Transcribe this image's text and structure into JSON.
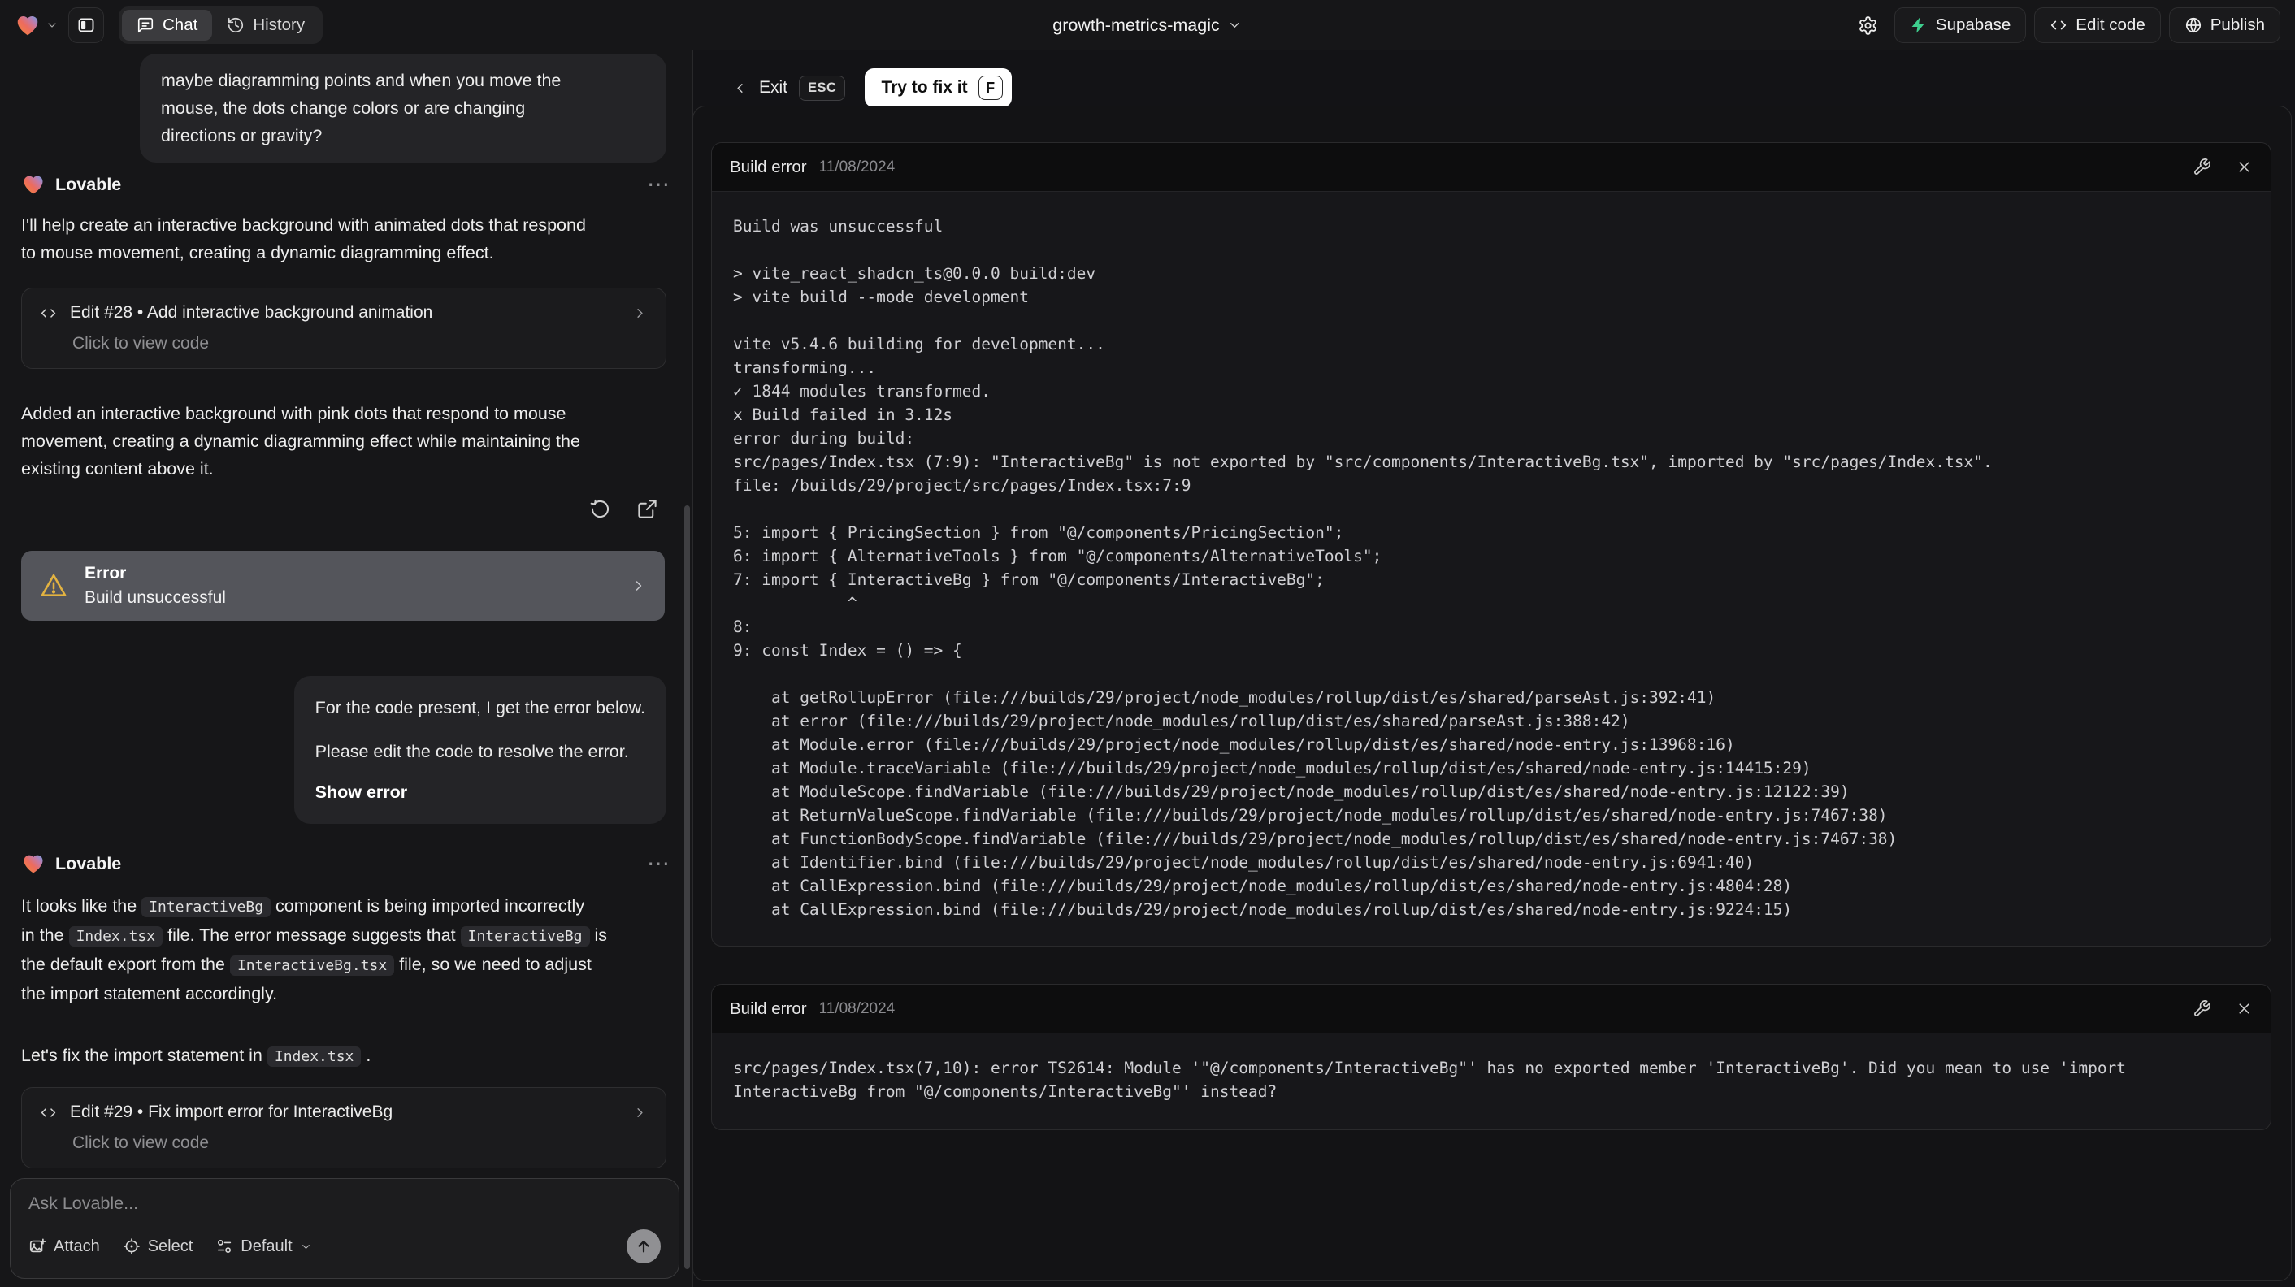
{
  "colors": {
    "accent_green": "#3ecf8e",
    "warning_amber": "#e3b341",
    "error_card_bg": "#54555b",
    "fix_button_bg": "#ffffff"
  },
  "topbar": {
    "tabs": [
      {
        "label": "Chat"
      },
      {
        "label": "History"
      }
    ],
    "project_name": "growth-metrics-magic",
    "actions": [
      {
        "label": "Supabase"
      },
      {
        "label": "Edit code"
      },
      {
        "label": "Publish"
      }
    ]
  },
  "chat": {
    "assistant_name": "Lovable",
    "menu_glyph": "⋯",
    "user_message_1_lines": [
      "maybe diagramming points and when you move the",
      "mouse, the dots change colors or are changing",
      "directions or gravity?"
    ],
    "message_1_lines": [
      "I'll help create an interactive background with animated dots that respond",
      "to mouse movement, creating a dynamic diagramming effect."
    ],
    "edit_card_28": {
      "title": "Edit #28 • Add interactive background animation",
      "subtitle": "Click to view code"
    },
    "message_1b_lines": [
      "Added an interactive background with pink dots that respond to mouse",
      "movement, creating a dynamic diagramming effect while maintaining the",
      "existing content above it."
    ],
    "error_card": {
      "title": "Error",
      "subtitle": "Build unsuccessful"
    },
    "user_message_2": {
      "line1": "For the code present, I get the error below.",
      "line2": "Please edit the code to resolve the error.",
      "link": "Show error"
    },
    "message_2_segments": [
      {
        "t": "text",
        "v": "It looks like the "
      },
      {
        "t": "code",
        "v": "InteractiveBg"
      },
      {
        "t": "text",
        "v": " component is being imported incorrectly"
      },
      {
        "t": "br"
      },
      {
        "t": "text",
        "v": "in the "
      },
      {
        "t": "code",
        "v": "Index.tsx"
      },
      {
        "t": "text",
        "v": " file. The error message suggests that "
      },
      {
        "t": "code",
        "v": "InteractiveBg"
      },
      {
        "t": "text",
        "v": " is"
      },
      {
        "t": "br"
      },
      {
        "t": "text",
        "v": "the default export from the "
      },
      {
        "t": "code",
        "v": "InteractiveBg.tsx"
      },
      {
        "t": "text",
        "v": " file, so we need to adjust"
      },
      {
        "t": "br"
      },
      {
        "t": "text",
        "v": "the import statement accordingly."
      }
    ],
    "message_2b_segments": [
      {
        "t": "text",
        "v": "Let's fix the import statement in "
      },
      {
        "t": "code",
        "v": "Index.tsx"
      },
      {
        "t": "text",
        "v": " ."
      }
    ],
    "edit_card_29": {
      "title": "Edit #29 • Fix import error for InteractiveBg",
      "subtitle": "Click to view code"
    },
    "input": {
      "placeholder": "Ask Lovable...",
      "attach_label": "Attach",
      "select_label": "Select",
      "mode_label": "Default"
    }
  },
  "workbench": {
    "exit_label": "Exit",
    "exit_key": "ESC",
    "fix_button_label": "Try to fix it",
    "fix_button_key": "F",
    "panels": [
      {
        "title": "Build error",
        "date": "11/08/2024",
        "log_lines": [
          "Build was unsuccessful",
          "",
          "> vite_react_shadcn_ts@0.0.0 build:dev",
          "> vite build --mode development",
          "",
          "vite v5.4.6 building for development...",
          "transforming...",
          "✓ 1844 modules transformed.",
          "x Build failed in 3.12s",
          "error during build:",
          "src/pages/Index.tsx (7:9): \"InteractiveBg\" is not exported by \"src/components/InteractiveBg.tsx\", imported by \"src/pages/Index.tsx\".",
          "file: /builds/29/project/src/pages/Index.tsx:7:9",
          "",
          "5: import { PricingSection } from \"@/components/PricingSection\";",
          "6: import { AlternativeTools } from \"@/components/AlternativeTools\";",
          "7: import { InteractiveBg } from \"@/components/InteractiveBg\";",
          "            ^",
          "8: ",
          "9: const Index = () => {",
          "",
          "    at getRollupError (file:///builds/29/project/node_modules/rollup/dist/es/shared/parseAst.js:392:41)",
          "    at error (file:///builds/29/project/node_modules/rollup/dist/es/shared/parseAst.js:388:42)",
          "    at Module.error (file:///builds/29/project/node_modules/rollup/dist/es/shared/node-entry.js:13968:16)",
          "    at Module.traceVariable (file:///builds/29/project/node_modules/rollup/dist/es/shared/node-entry.js:14415:29)",
          "    at ModuleScope.findVariable (file:///builds/29/project/node_modules/rollup/dist/es/shared/node-entry.js:12122:39)",
          "    at ReturnValueScope.findVariable (file:///builds/29/project/node_modules/rollup/dist/es/shared/node-entry.js:7467:38)",
          "    at FunctionBodyScope.findVariable (file:///builds/29/project/node_modules/rollup/dist/es/shared/node-entry.js:7467:38)",
          "    at Identifier.bind (file:///builds/29/project/node_modules/rollup/dist/es/shared/node-entry.js:6941:40)",
          "    at CallExpression.bind (file:///builds/29/project/node_modules/rollup/dist/es/shared/node-entry.js:4804:28)",
          "    at CallExpression.bind (file:///builds/29/project/node_modules/rollup/dist/es/shared/node-entry.js:9224:15)"
        ]
      },
      {
        "title": "Build error",
        "date": "11/08/2024",
        "log_lines": [
          "src/pages/Index.tsx(7,10): error TS2614: Module '\"@/components/InteractiveBg\"' has no exported member 'InteractiveBg'. Did you mean to use 'import InteractiveBg from \"@/components/InteractiveBg\"' instead?"
        ]
      }
    ]
  }
}
